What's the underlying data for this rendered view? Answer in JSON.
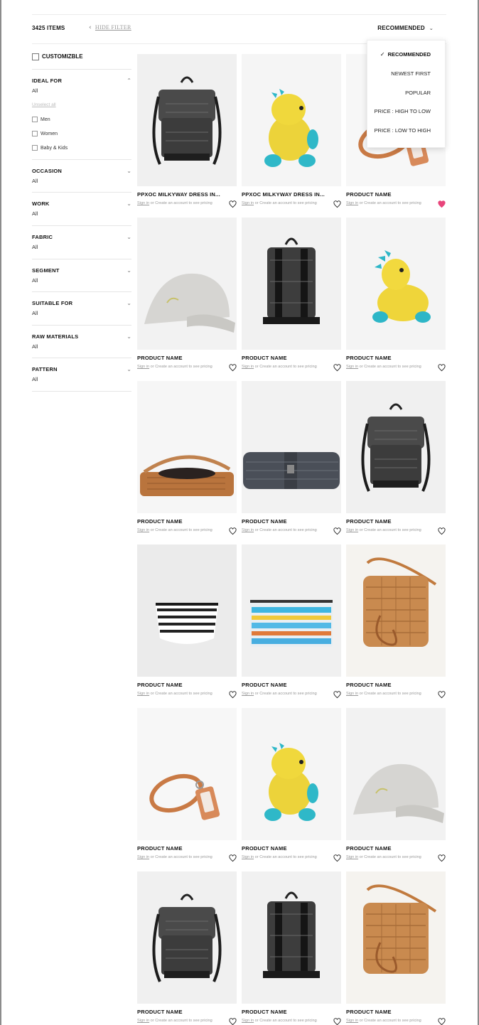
{
  "toolbar": {
    "items_count": "3425 ITEMS",
    "hide_filter": "HIDE FILTER",
    "sort_label": "RECOMMENDED",
    "sort_options": [
      "RECOMMENDED",
      "NEWEST FIRST",
      "POPULAR",
      "PRICE : HIGH TO LOW",
      "PRICE : LOW TO HIGH"
    ],
    "sort_selected": "RECOMMENDED"
  },
  "filters": {
    "customizable_label": "CUSTOMIZBLE",
    "ideal_for": {
      "title": "IDEAL FOR",
      "value": "All",
      "unselect_all": "Unselect all",
      "options": [
        "Men",
        "Women",
        "Baby & Kids"
      ]
    },
    "groups": [
      {
        "title": "OCCASION",
        "value": "All"
      },
      {
        "title": "WORK",
        "value": "All"
      },
      {
        "title": "FABRIC",
        "value": "All"
      },
      {
        "title": "SEGMENT",
        "value": "All"
      },
      {
        "title": "SUITABLE FOR",
        "value": "All"
      },
      {
        "title": "RAW MATERIALS",
        "value": "All"
      },
      {
        "title": "PATTERN",
        "value": "All"
      }
    ]
  },
  "pricing_text": {
    "sign_in": "Sign in",
    "rest": " or Create an account to see pricing"
  },
  "colors": {
    "accent_heart": "#e8457b",
    "text_primary": "#111111",
    "muted": "#999999"
  },
  "products": [
    {
      "name": "PPXOC MILKYWAY DRESS IN...",
      "image": "black-rolltop-backpack",
      "favorited": false
    },
    {
      "name": "PPXOC MILKYWAY DRESS IN...",
      "image": "yellow-crochet-dino-toy",
      "favorited": false
    },
    {
      "name": "PRODUCT NAME",
      "image": "tan-leather-lanyard",
      "favorited": true
    },
    {
      "name": "PRODUCT NAME",
      "image": "grey-cap",
      "favorited": false
    },
    {
      "name": "PRODUCT NAME",
      "image": "black-backpack-rear",
      "favorited": false
    },
    {
      "name": "PRODUCT NAME",
      "image": "yellow-crochet-dino-side",
      "favorited": false
    },
    {
      "name": "PRODUCT NAME",
      "image": "tan-woven-bag-flat",
      "favorited": false
    },
    {
      "name": "PRODUCT NAME",
      "image": "grey-rolled-pouch",
      "favorited": false
    },
    {
      "name": "PRODUCT NAME",
      "image": "black-rolltop-backpack",
      "favorited": false
    },
    {
      "name": "PRODUCT NAME",
      "image": "striped-pouch",
      "favorited": false
    },
    {
      "name": "PRODUCT NAME",
      "image": "multicolor-zip-pouch",
      "favorited": false
    },
    {
      "name": "PRODUCT NAME",
      "image": "tan-woven-crossbody",
      "favorited": false
    },
    {
      "name": "PRODUCT NAME",
      "image": "tan-leather-lanyard",
      "favorited": false
    },
    {
      "name": "PRODUCT NAME",
      "image": "yellow-crochet-dino-toy",
      "favorited": false
    },
    {
      "name": "PRODUCT NAME",
      "image": "grey-cap",
      "favorited": false
    },
    {
      "name": "PRODUCT NAME",
      "image": "black-rolltop-backpack",
      "favorited": false
    },
    {
      "name": "PRODUCT NAME",
      "image": "black-backpack-rear",
      "favorited": false
    },
    {
      "name": "PRODUCT NAME",
      "image": "tan-woven-crossbody",
      "favorited": false
    }
  ]
}
